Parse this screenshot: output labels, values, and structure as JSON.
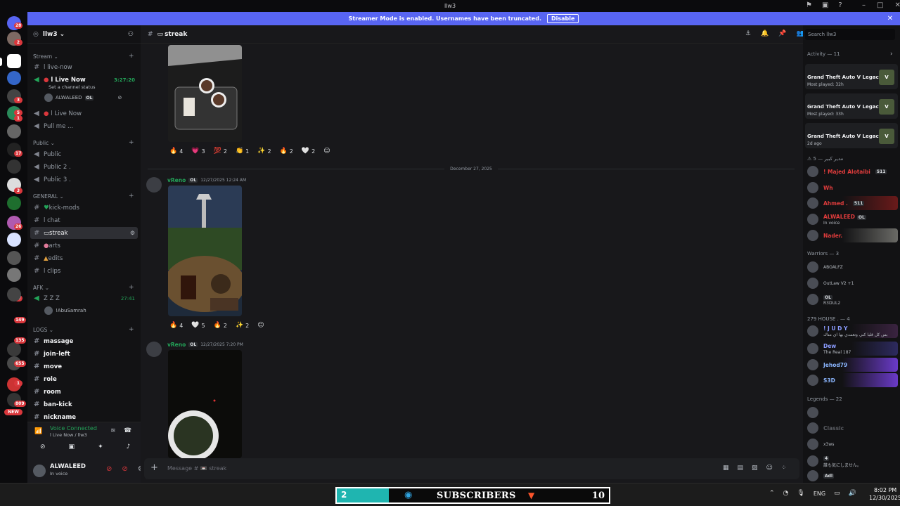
{
  "window": {
    "title": "llw3"
  },
  "banner": {
    "text": "Streamer Mode is enabled. Usernames have been truncated.",
    "button": "Disable"
  },
  "guild_badges": [
    "28",
    "2",
    "3",
    "5",
    "1",
    "17",
    "3",
    "26",
    "77",
    "149",
    "135",
    "655",
    "1",
    "809"
  ],
  "guild_new": "NEW",
  "server": {
    "name": "llw3"
  },
  "categories": {
    "stream": "Stream",
    "public": "Public",
    "general": "GENERAL",
    "afk": "AFK",
    "logs": "LOGS"
  },
  "channels": {
    "live_now_text": "l live-now",
    "live_now_voice": "l Live Now",
    "live_now_time": "3:27:20",
    "channel_status": "Set a channel status",
    "voice_user": "ALWALEED",
    "voice_user_tag": "OL",
    "live_now_voice2": "l Live Now",
    "pull_me": "Pull me ...",
    "public1": "Public",
    "public2": "Public 2 .",
    "public3": "Public 3 .",
    "kick_mods": "kick-mods",
    "chat": "l chat",
    "streak": "streak",
    "arts": "arts",
    "edits": "edits",
    "clips": "l clips",
    "afk_channel": "Z Z Z",
    "afk_time": "27:41",
    "afk_user": "!AbuSamrah",
    "massage": "massage",
    "join_left": "join-left",
    "move": "move",
    "role": "role",
    "room": "room",
    "ban_kick": "ban-kick",
    "nickname": "nickname"
  },
  "voice": {
    "status": "Voice Connected",
    "location": "l Live Now / llw3"
  },
  "user": {
    "name": "ALWALEED",
    "status": "In voice"
  },
  "header": {
    "channel": "streak"
  },
  "messages": [
    {
      "reactions": [
        {
          "e": "🔥",
          "n": "4"
        },
        {
          "e": "💗",
          "n": "3"
        },
        {
          "e": "💯",
          "n": "2"
        },
        {
          "e": "👏",
          "n": "1"
        },
        {
          "e": "✨",
          "n": "2"
        },
        {
          "e": "🔥",
          "n": "2"
        },
        {
          "e": "🤍",
          "n": "2"
        }
      ]
    },
    {
      "author": "vReno",
      "tag": "OL",
      "time": "12/27/2025 12:24 AM",
      "reactions": [
        {
          "e": "🔥",
          "n": "4"
        },
        {
          "e": "🤍",
          "n": "5"
        },
        {
          "e": "🔥",
          "n": "2"
        },
        {
          "e": "✨",
          "n": "2"
        }
      ]
    },
    {
      "author": "vReno",
      "tag": "OL",
      "time": "12/27/2025 7:20 PM"
    }
  ],
  "date_divider": "December 27, 2025",
  "composer": {
    "placeholder": "Message # 📼 streak"
  },
  "members_panel": {
    "search": "Search llw3",
    "activity_label": "Activity — 11",
    "activities": [
      {
        "game": "Grand Theft Auto V Legacy",
        "sub": "Most played: 32h"
      },
      {
        "game": "Grand Theft Auto V Legacy",
        "sub": "Most played: 33h"
      },
      {
        "game": "Grand Theft Auto V Legacy",
        "sub": "2d ago"
      }
    ],
    "group1": "⚠ 5 — مدير كبير",
    "g1_members": [
      {
        "name": "! Majed Alotaibi",
        "tag": "511",
        "color": "#e03c3c"
      },
      {
        "name": "Wh",
        "color": "#e03c3c"
      },
      {
        "name": "Ahmed .",
        "tag": "511",
        "color": "#e03c3c"
      },
      {
        "name": "ALWALEED",
        "tag": "OL",
        "status": "In voice",
        "color": "#e03c3c"
      },
      {
        "name": "Nader.",
        "color": "#e03c3c"
      }
    ],
    "group2": "Warriors — 3",
    "g2_members": [
      {
        "name": "",
        "status": "ABOALFZ",
        "color": "#3b6cff"
      },
      {
        "name": "",
        "status": "OutLaw V2 +1",
        "color": "#3b6cff"
      },
      {
        "name": "",
        "tag": "OL",
        "status": "R3DUL2",
        "color": "#3b6cff"
      }
    ],
    "group3": "279 HOUSE . — 4",
    "g3_members": [
      {
        "name": "! J U D Y",
        "status": "بس كل قلبا كني وتعمدي بها اي متاك",
        "color": "#8b9cff"
      },
      {
        "name": "Dew",
        "status": "The Real 187",
        "color": "#8b9cff"
      },
      {
        "name": "Jehod79",
        "color": "#8bb6ff"
      },
      {
        "name": "S3D",
        "color": "#8bb6ff"
      }
    ],
    "group4": "Legends — 22",
    "g4_members": [
      {
        "name": "",
        "color": "#b5bac1"
      },
      {
        "name": "Classic",
        "color": "#5a5d63"
      },
      {
        "name": "",
        "status": "x3ws",
        "color": "#b5bac1"
      },
      {
        "name": "",
        "tag": "4",
        "status": "誰も気にしません。",
        "color": "#b5bac1"
      },
      {
        "name": "",
        "tag": "Adl",
        "color": "#b5bac1"
      }
    ]
  },
  "taskbar": {
    "overlay_count_left": "2",
    "overlay_label": "SUBSCRIBERS",
    "overlay_count_right": "10",
    "lang": "ENG",
    "time": "8:02 PM",
    "date": "12/30/2025"
  },
  "colors": {
    "accent": "#5865f2",
    "online": "#23a559",
    "danger": "#da373c"
  }
}
